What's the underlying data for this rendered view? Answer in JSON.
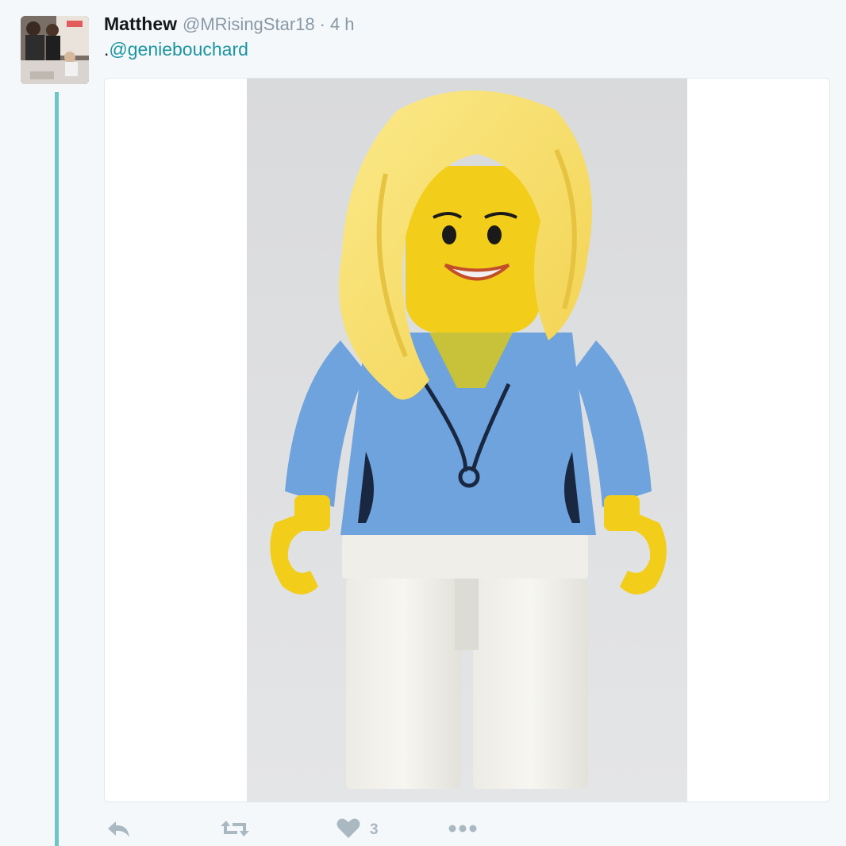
{
  "tweet": {
    "author_name": "Matthew",
    "handle": "@MRisingStar18",
    "separator": "·",
    "time": "4 h",
    "text_prefix": ".",
    "mention": "@geniebouchard",
    "like_count": "3"
  },
  "icons": {
    "reply": "reply-icon",
    "retweet": "retweet-icon",
    "like": "heart-icon",
    "more": "more-dots-icon"
  },
  "colors": {
    "accent": "#1b95a0",
    "thread_line": "#6ac6c7",
    "muted": "#8899a6",
    "action_icon": "#aab8c2"
  }
}
